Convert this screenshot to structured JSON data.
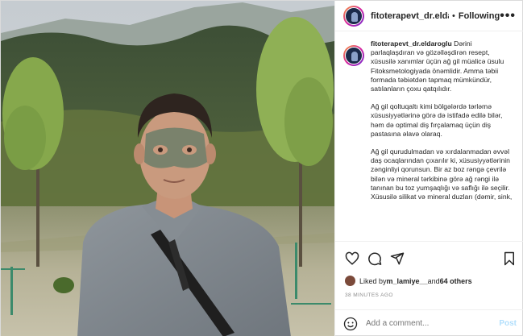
{
  "header": {
    "username": "fitoterapevt_dr.eldarog",
    "separator": "•",
    "follow_label": "Following",
    "more_label": "•••"
  },
  "caption": {
    "author": "fitoterapevt_dr.eldaroglu",
    "paragraphs": [
      "Dərini parlaqlaşdıran və gözəlləşdirən resept, xüsusilə xanımlar üçün ağ gil müalicə üsulu Fitoksmetologiyada önəmlidir. Amma təbii formada təbiətdən tapmaq mümkündür, satılanların çoxu qatqılıdır.",
      "Ağ gil qoltuqaltı kimi bölgələrdə tərləmə xüsusiyyətlərinə görə də istifadə edilə bilər, həm də optimal diş fırçalamaq üçün diş pastasına əlavə olaraq.",
      "Ağ gil qurudulmadan və xırdalanmadan əvvəl daş ocaqlarından çıxarılır ki, xüsusiyyətlərinin zənginliyi qorunsun. Bir az boz rəngə çevrilə bilən və mineral tərkibinə görə ağ rəngi ilə tanınan bu toz yumşaqlığı və saflığı ilə seçilir. Xüsusilə silikat və mineral duzları (dəmir, sink,"
    ]
  },
  "likes": {
    "prefix": "Liked by ",
    "user": "m_lamiye__",
    "middle": " and ",
    "others": "64 others"
  },
  "timestamp": "38 MINUTES AGO",
  "comment": {
    "placeholder": "Add a comment...",
    "post_label": "Post"
  },
  "colors": {
    "link": "#0095f6",
    "post_disabled": "#b2dffc",
    "muted": "#8e8e8e"
  }
}
